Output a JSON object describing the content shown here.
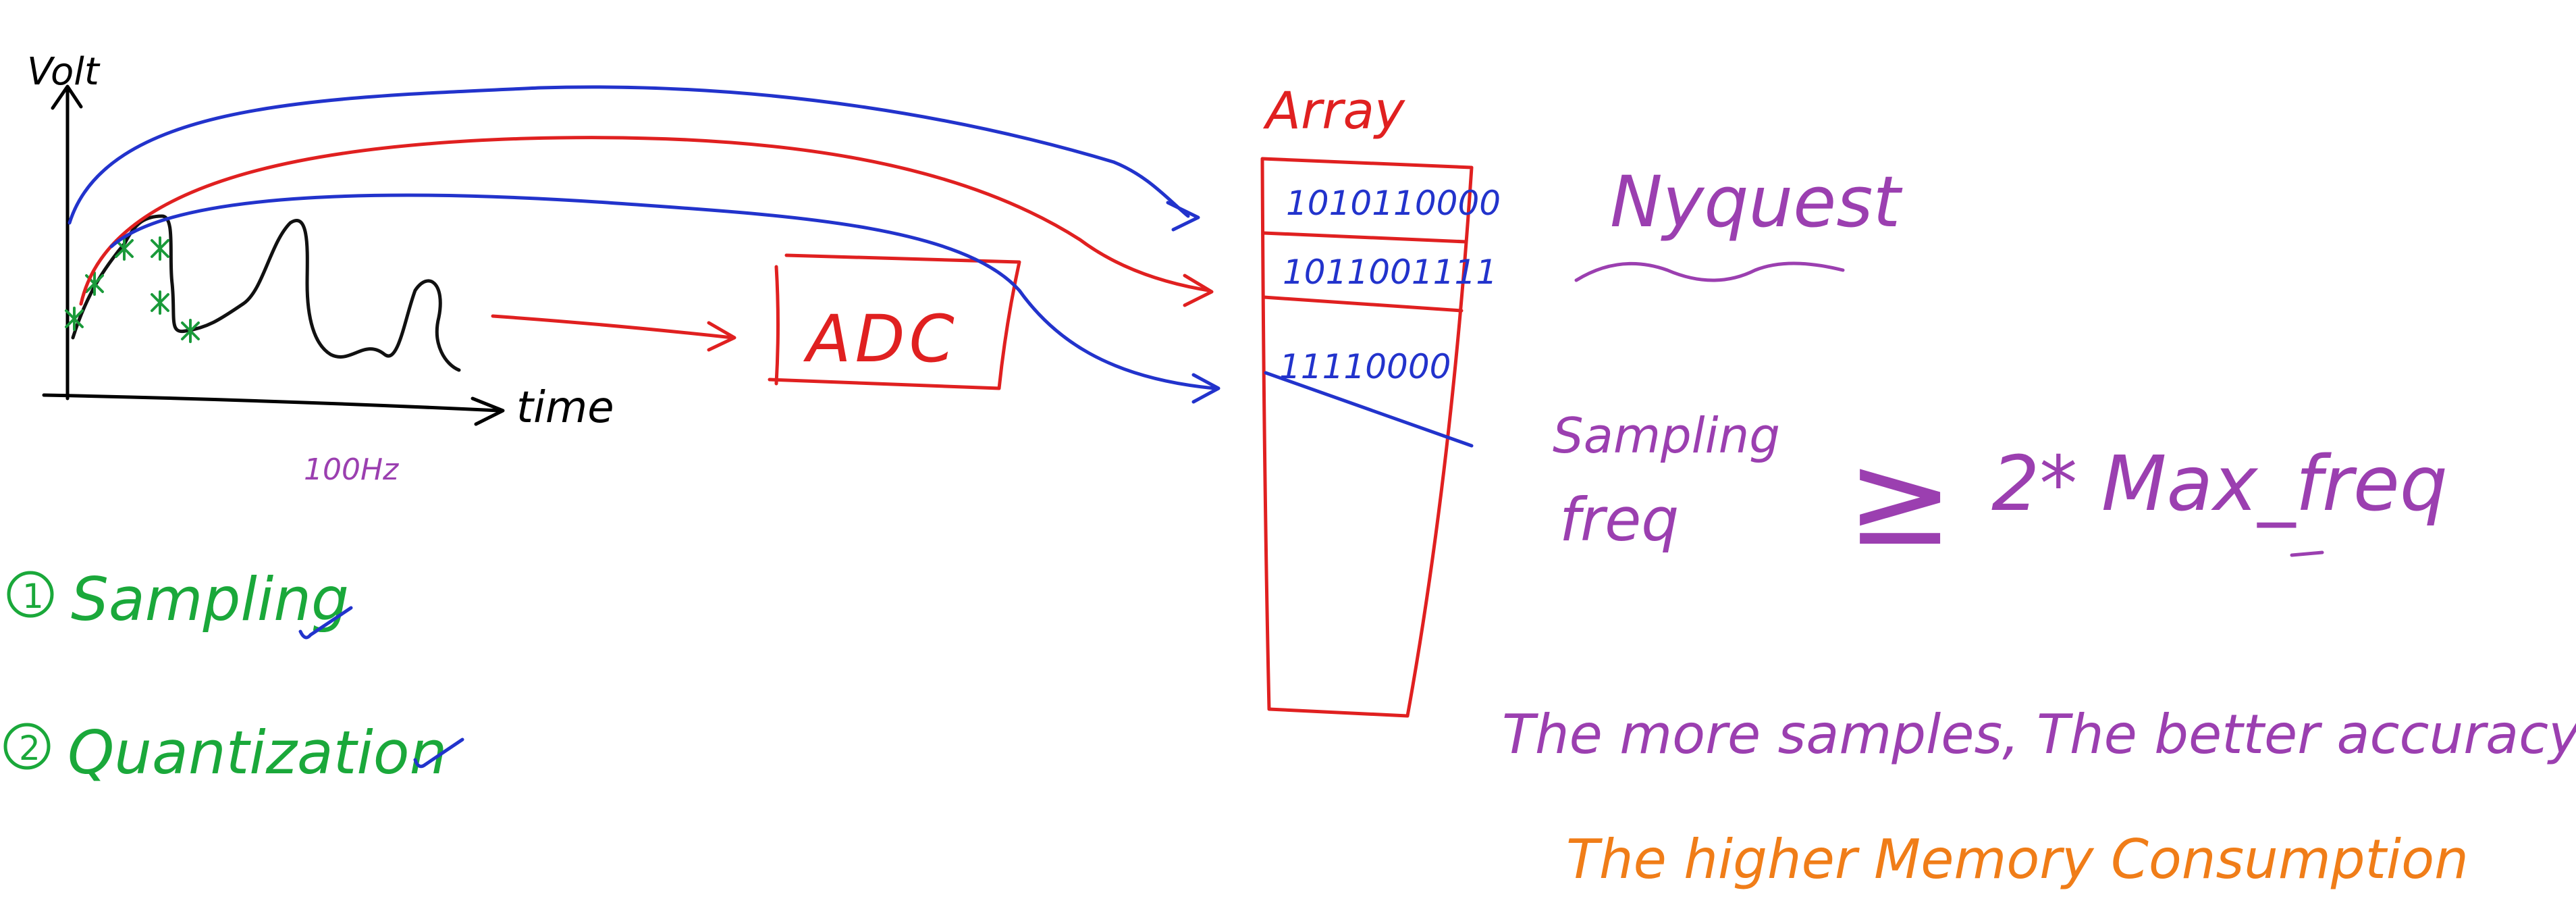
{
  "graph": {
    "y_axis_label": "Volt",
    "x_axis_label": "time",
    "freq_note": "100Hz"
  },
  "adc": {
    "label": "ADC"
  },
  "array": {
    "title": "Array",
    "rows": [
      "1010110000",
      "1011001111",
      "11110000"
    ]
  },
  "steps": [
    {
      "number": "1",
      "label": "Sampling"
    },
    {
      "number": "2",
      "label": "Quantization"
    }
  ],
  "nyquest": {
    "title": "Nyquest",
    "lhs_line1": "Sampling",
    "lhs_line2": "freq",
    "operator": "≥",
    "rhs": "2* Max_freq"
  },
  "notes": {
    "accuracy": "The more samples, The better accuracy",
    "memory": "The higher Memory Consumption"
  },
  "colors": {
    "axis": "#000000",
    "signal": "#000000",
    "sample_marker": "#1a9a3a",
    "red": "#e02020",
    "blue": "#2233cc",
    "green": "#1aa83a",
    "purple": "#9b3fb0",
    "orange": "#f07d18"
  }
}
